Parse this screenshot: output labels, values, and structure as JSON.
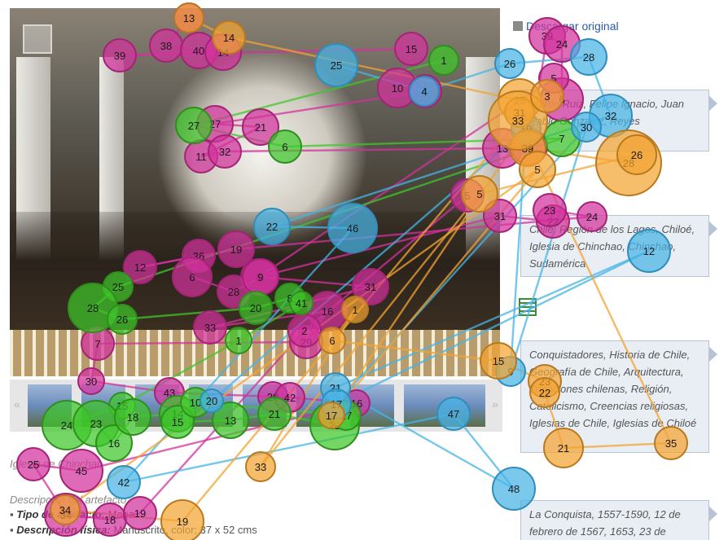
{
  "download_label": "Descargar original",
  "tag_boxes": [
    {
      "id": "authors",
      "text": "Martín Ruiz, Felipe Ignacio, Juan Pablo Gonzalez, Reyes"
    },
    {
      "id": "places",
      "text": "Chile, Región de los Lagos, Chiloé, Iglesia de Chinchao, Chinchao, Sudamérica"
    },
    {
      "id": "subjects",
      "text": "Conquistadores, Historia de Chile, Geografía de Chile, Arquitectura, Tradiciones chilenas, Religión, Catolicismo, Creencias religiosas, Iglesias de Chile, Iglesias de Chiloé"
    },
    {
      "id": "dates",
      "text": "La Conquista, 1557-1590, 12 de febrero de 1567, 1653, 23 de"
    }
  ],
  "caption": "Iglesia de Chinchao",
  "description_heading": "Descripción del artefacto",
  "details": [
    {
      "label": "Tipo de artefacto:",
      "value": "Mapa"
    },
    {
      "label": "Descripción física:",
      "value": "Manuscrito, color; 37 x 52 cms"
    }
  ],
  "thumb_nav": {
    "prev": "«",
    "next": "»"
  },
  "fixations": {
    "pink": [
      "13",
      "38",
      "40",
      "14",
      "39",
      "15",
      "10",
      "4",
      "27",
      "21",
      "11",
      "32",
      "13",
      "3",
      "39",
      "24",
      "6",
      "5",
      "8",
      "31",
      "22",
      "23",
      "24",
      "19",
      "12",
      "36",
      "6",
      "28",
      "9",
      "31",
      "33",
      "16",
      "29",
      "7",
      "30",
      "43",
      "20",
      "42",
      "16",
      "45",
      "25",
      "34",
      "18",
      "19",
      "2",
      "5"
    ],
    "green": [
      "1",
      "27",
      "6",
      "7",
      "25",
      "28",
      "26",
      "20",
      "8",
      "41",
      "1",
      "15",
      "24",
      "23",
      "16",
      "18",
      "14",
      "15",
      "13",
      "21",
      "22",
      "17",
      "10"
    ],
    "blue": [
      "25",
      "4",
      "26",
      "28",
      "32",
      "22",
      "46",
      "42",
      "47",
      "48",
      "21",
      "12",
      "17",
      "30",
      "9",
      "10",
      "20"
    ],
    "orange": [
      "13",
      "14",
      "25",
      "31",
      "39",
      "28",
      "26",
      "5",
      "33",
      "1",
      "6",
      "15",
      "23",
      "22",
      "21",
      "35",
      "33",
      "19",
      "34",
      "5",
      "17",
      "3"
    ]
  },
  "colors": {
    "pink": "#d2329c",
    "green": "#3fc62a",
    "blue": "#46b4e6",
    "orange": "#f3a332",
    "link": "#2a5aa6"
  }
}
